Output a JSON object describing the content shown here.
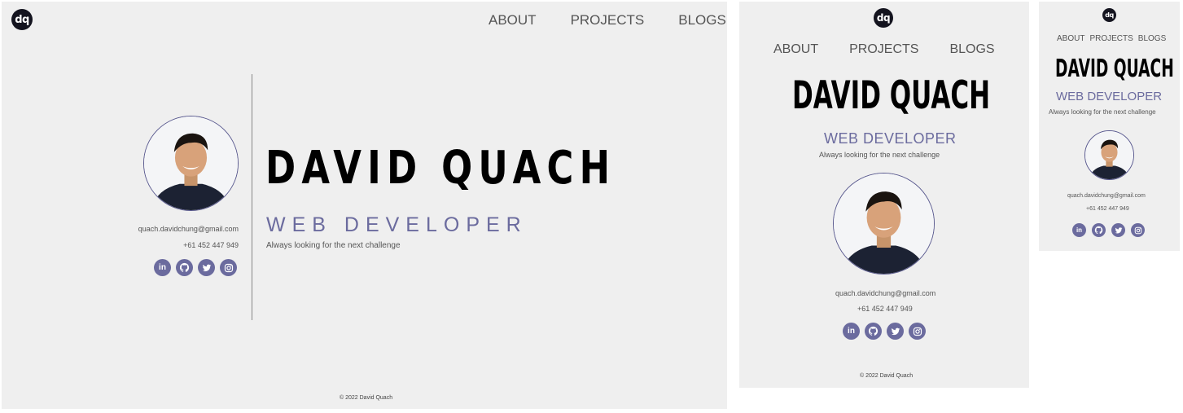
{
  "brand": {
    "logo_text": "dq"
  },
  "nav": {
    "about": "ABOUT",
    "projects": "PROJECTS",
    "blogs": "BLOGS"
  },
  "profile": {
    "name": "DAVID QUACH",
    "role": "WEB DEVELOPER",
    "tagline": "Always looking for the next challenge",
    "email": "quach.davidchung@gmail.com",
    "phone": "+61 452 447 949"
  },
  "socials": [
    {
      "name": "linkedin",
      "icon": "linkedin-icon"
    },
    {
      "name": "github",
      "icon": "github-icon"
    },
    {
      "name": "twitter",
      "icon": "twitter-icon"
    },
    {
      "name": "instagram",
      "icon": "instagram-icon"
    }
  ],
  "footer": {
    "copyright": "© 2022 David Quach"
  },
  "colors": {
    "accent": "#6b6b9e",
    "background": "#efefef",
    "logo_bg": "#14141f",
    "text_dark": "#000000"
  }
}
